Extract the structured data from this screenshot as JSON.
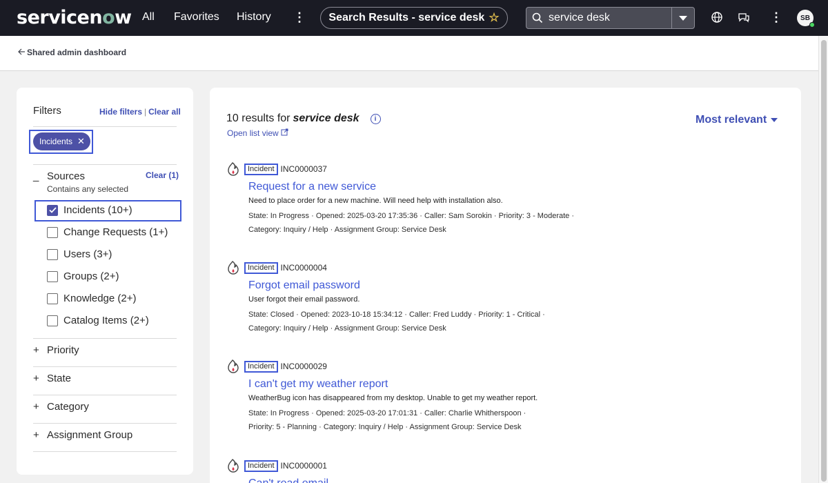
{
  "nav": {
    "logo": "servicenow",
    "links": [
      "All",
      "Favorites",
      "History"
    ],
    "context_title": "Search Results - service desk",
    "search_value": "service desk",
    "avatar_initials": "SB"
  },
  "breadcrumb": {
    "label": "Shared admin dashboard"
  },
  "filters": {
    "title": "Filters",
    "hide_label": "Hide filters",
    "clear_all_label": "Clear all",
    "chip_label": "Incidents",
    "sources": {
      "title": "Sources",
      "subtitle": "Contains any selected",
      "clear_label": "Clear (1)",
      "options": [
        {
          "label": "Incidents (10+)",
          "checked": true
        },
        {
          "label": "Change Requests (1+)",
          "checked": false
        },
        {
          "label": "Users (3+)",
          "checked": false
        },
        {
          "label": "Groups (2+)",
          "checked": false
        },
        {
          "label": "Knowledge (2+)",
          "checked": false
        },
        {
          "label": "Catalog Items (2+)",
          "checked": false
        }
      ]
    },
    "accordions": [
      "Priority",
      "State",
      "Category",
      "Assignment Group"
    ]
  },
  "results": {
    "count_prefix": "10 results for",
    "query": "service desk",
    "open_list_label": "Open list view",
    "sort_label": "Most relevant",
    "items": [
      {
        "type": "Incident",
        "number": "INC0000037",
        "title": "Request for a new service",
        "description": "Need to place order for a new machine. Will need help with installation also.",
        "meta_line1": "State: In Progress · Opened: 2025-03-20 17:35:36 · Caller: Sam Sorokin · Priority: 3 - Moderate ·",
        "meta_line2": "Category: Inquiry / Help · Assignment Group: Service Desk"
      },
      {
        "type": "Incident",
        "number": "INC0000004",
        "title": "Forgot email password",
        "description": "User forgot their email password.",
        "meta_line1": "State: Closed · Opened: 2023-10-18 15:34:12 · Caller: Fred Luddy · Priority: 1 - Critical ·",
        "meta_line2": "Category: Inquiry / Help · Assignment Group: Service Desk"
      },
      {
        "type": "Incident",
        "number": "INC0000029",
        "title": "I can't get my weather report",
        "description": "WeatherBug icon has disappeared from my desktop. Unable to get my weather report.",
        "meta_line1": "State: In Progress · Opened: 2025-03-20 17:01:31 · Caller: Charlie Whitherspoon ·",
        "meta_line2": "Priority: 5 - Planning · Category: Inquiry / Help · Assignment Group: Service Desk"
      },
      {
        "type": "Incident",
        "number": "INC0000001",
        "title": "Can't read email",
        "description": "",
        "meta_line1": "",
        "meta_line2": ""
      }
    ]
  },
  "colors": {
    "nav_bg": "#1a1b24",
    "accent": "#3f4fb4",
    "chip": "#4d51a6",
    "highlight_frame": "#3f58d6"
  }
}
